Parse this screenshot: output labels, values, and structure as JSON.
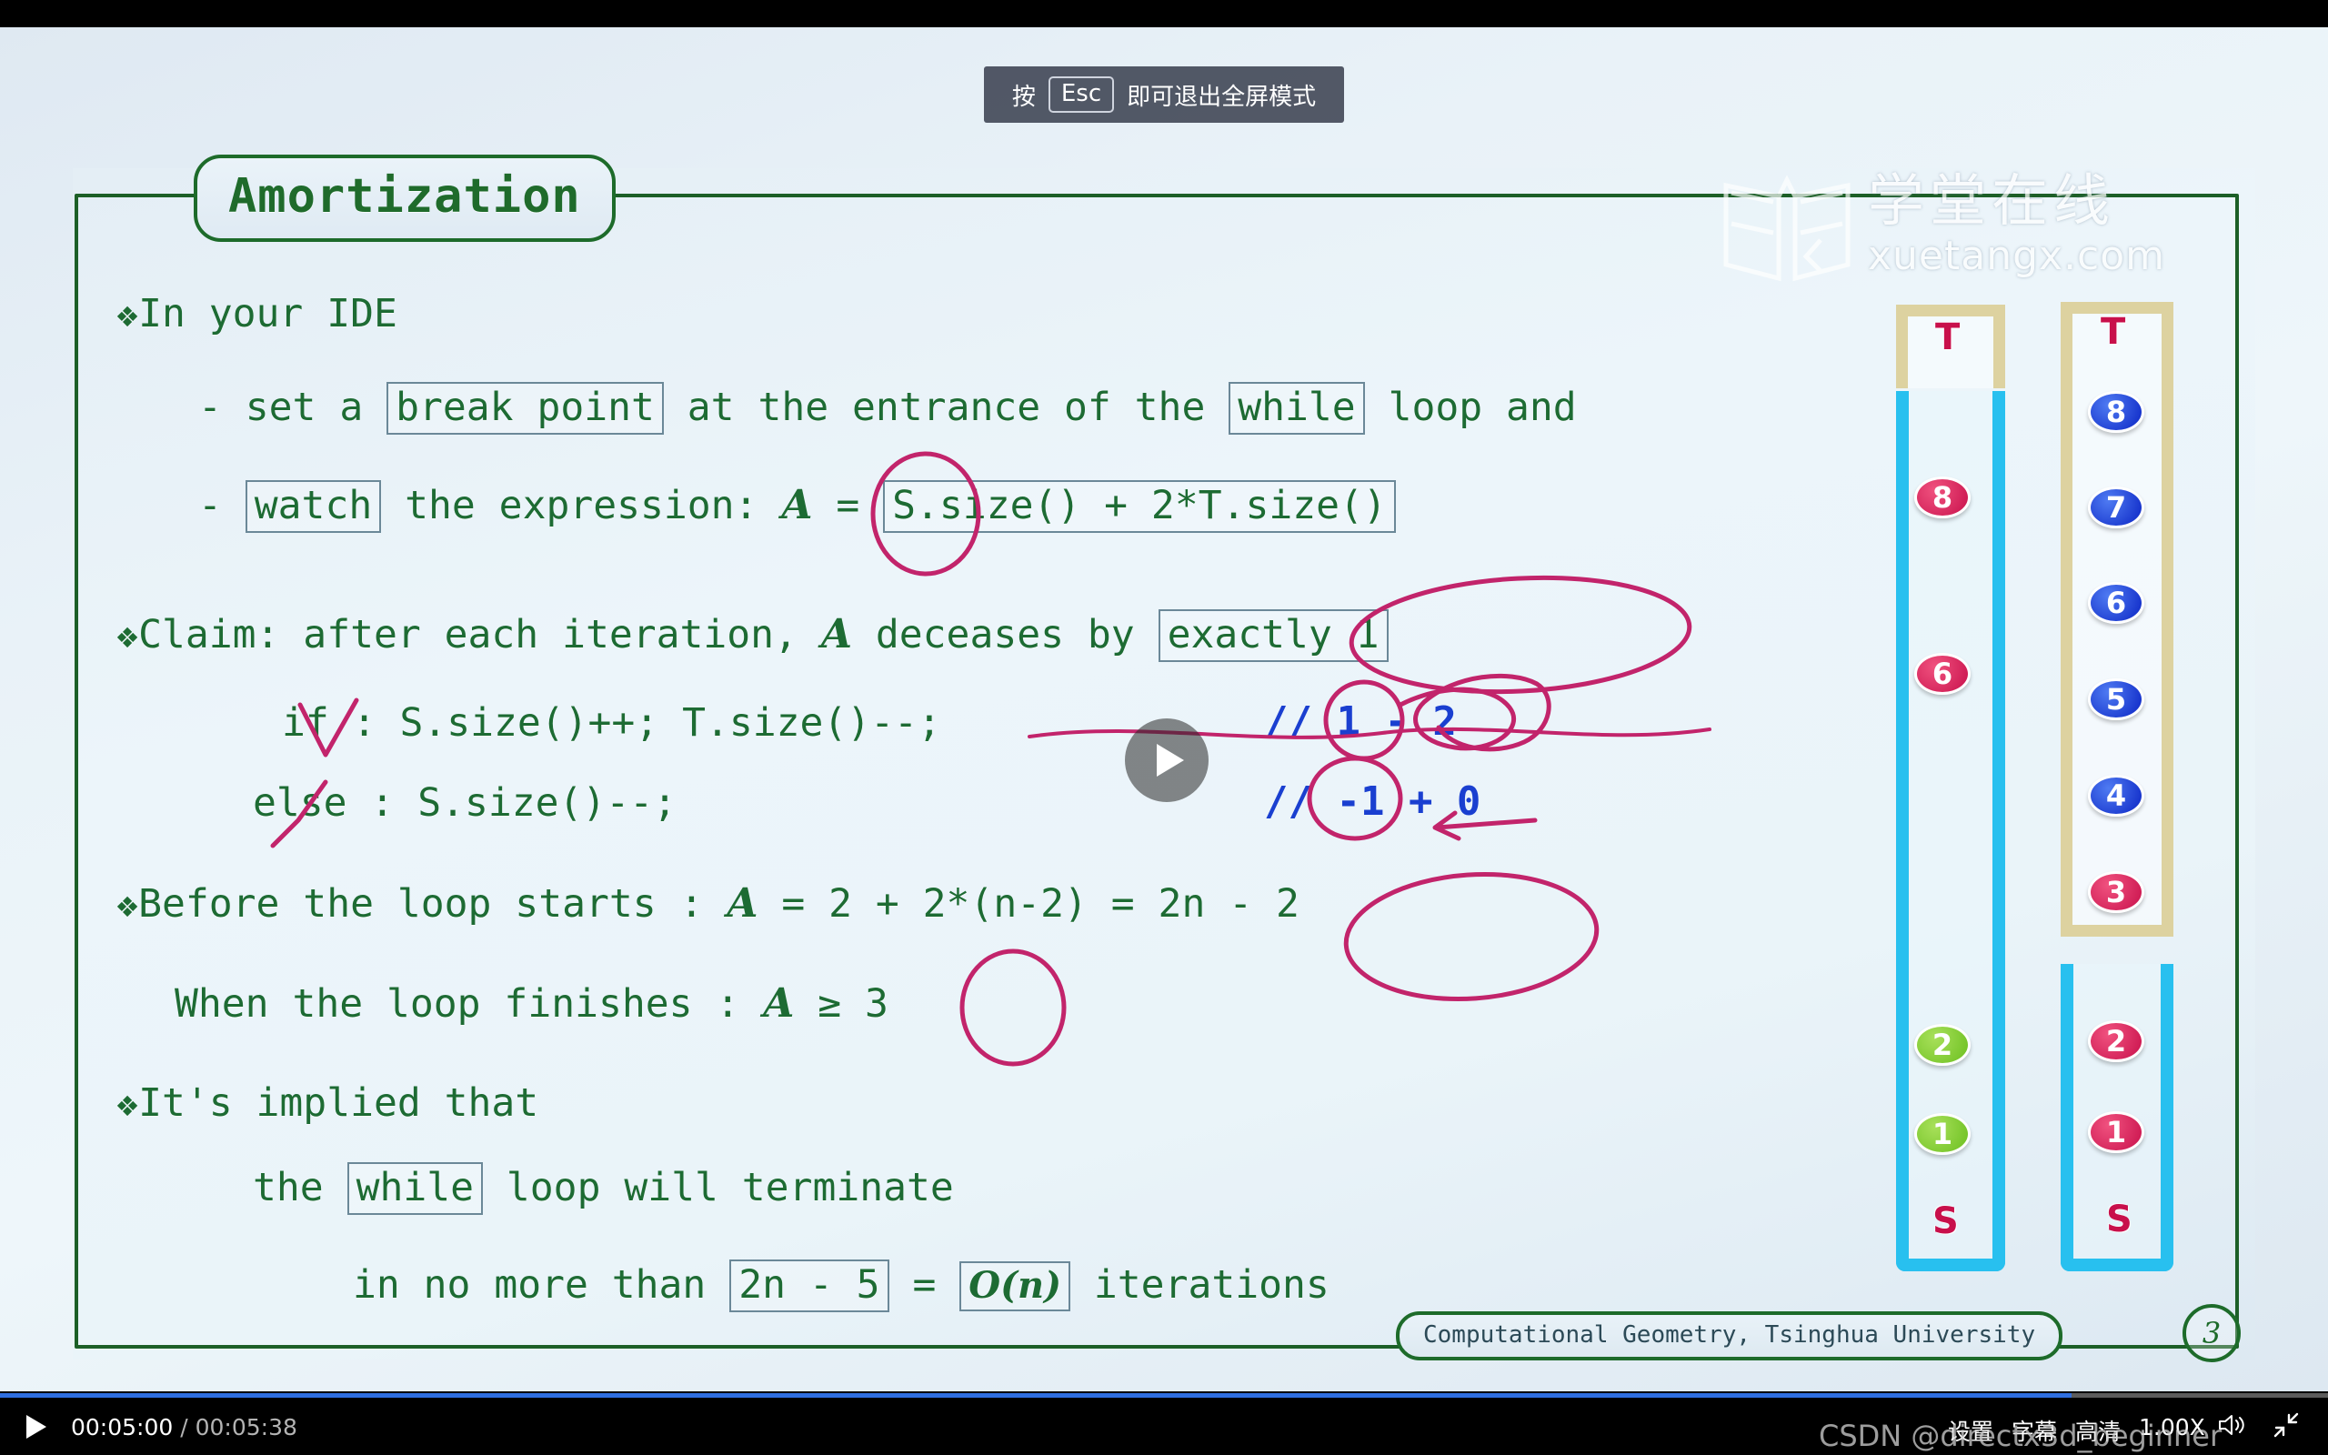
{
  "esc_banner": {
    "prefix": "按",
    "key": "Esc",
    "suffix": "即可退出全屏模式"
  },
  "slide": {
    "title": "Amortization",
    "footer": "Computational Geometry, Tsinghua University",
    "page_number": "3",
    "lines": {
      "l1_bullet": "❖",
      "l1": "In your IDE",
      "l2_dash": "-",
      "l2_a": "set a",
      "l2_box": "break point",
      "l2_b": "at the entrance of the",
      "l2_box2": "while",
      "l2_c": "loop and",
      "l3_dash": "-",
      "l3_box": "watch",
      "l3_a": "the expression:",
      "l3_var": "A",
      "l3_eq": "=",
      "l3_box2": "S.size() + 2*T.size()",
      "l4_bullet": "❖",
      "l4_a": "Claim: after each iteration,",
      "l4_var": "A",
      "l4_b": "deceases by",
      "l4_box": "exactly 1",
      "l5": "if : S.size()++; T.size()--;",
      "l5_cmt": "// 1 - 2",
      "l6": "else : S.size()--;",
      "l6_cmt": "// -1 + 0",
      "l7_bullet": "❖",
      "l7_a": "Before the loop starts :",
      "l7_var": "A",
      "l7_b": "= 2 + 2*(n-2) = 2n - 2",
      "l8_a": "When the loop finishes :",
      "l8_var": "A",
      "l8_b": "≥ 3",
      "l9_bullet": "❖",
      "l9": "It's implied that",
      "l10_a": "the",
      "l10_box": "while",
      "l10_b": "loop will terminate",
      "l11_a": "in no more than",
      "l11_box": "2n - 5",
      "l11_eq": "=",
      "l11_box2": "O(n)",
      "l11_b": "iterations"
    }
  },
  "logo": {
    "cn": "学堂在线",
    "url": "xuetangx.com"
  },
  "stacks": {
    "left": {
      "top_label": "T",
      "bottom_label": "S",
      "items": [
        {
          "value": "8",
          "color": "red"
        },
        {
          "value": "6",
          "color": "red"
        },
        {
          "value": "2",
          "color": "green"
        },
        {
          "value": "1",
          "color": "green"
        }
      ]
    },
    "right": {
      "top_label": "T",
      "bottom_label": "S",
      "t_items": [
        {
          "value": "8",
          "color": "blue"
        },
        {
          "value": "7",
          "color": "blue"
        },
        {
          "value": "6",
          "color": "blue"
        },
        {
          "value": "5",
          "color": "blue"
        },
        {
          "value": "4",
          "color": "blue"
        },
        {
          "value": "3",
          "color": "red"
        }
      ],
      "s_items": [
        {
          "value": "2",
          "color": "red"
        },
        {
          "value": "1",
          "color": "red"
        }
      ]
    }
  },
  "player": {
    "current_time": "00:05:00",
    "separator": "/",
    "total_time": "00:05:38",
    "progress_percent": 89,
    "settings_label": "设置",
    "subtitles_label": "字幕",
    "quality_label": "高清",
    "speed_label": "1.00X",
    "watermark": "CSDN @directx3d_beginner"
  },
  "colors": {
    "slide_green": "#1d6b33",
    "ink_pink": "#c2246b",
    "comment_blue": "#1a3fd0",
    "chip_red": "#c8104b",
    "chip_blue": "#0a24c4",
    "chip_green": "#6bbf1f",
    "progress_blue": "#2f6fe0"
  }
}
